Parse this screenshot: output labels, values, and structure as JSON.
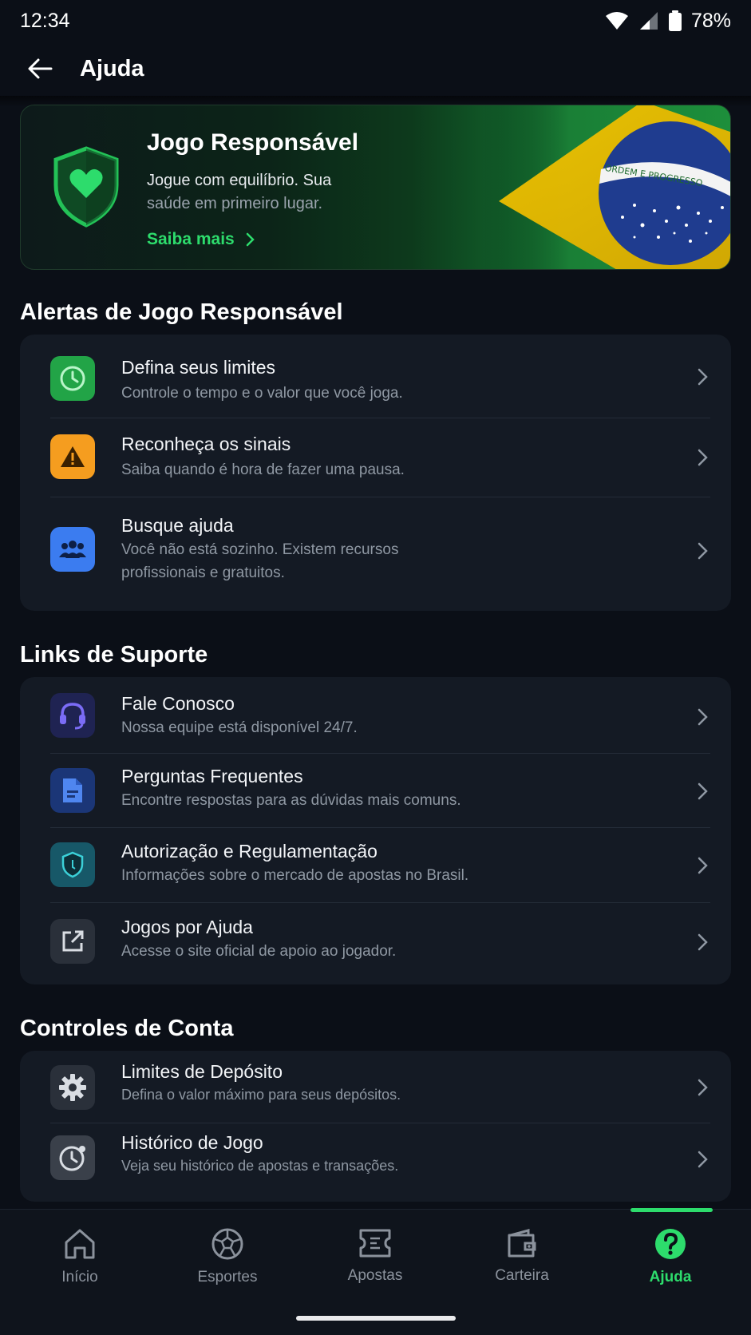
{
  "status": {
    "time": "12:34",
    "battery": "78%"
  },
  "header": {
    "title": "Ajuda",
    "back_icon": "arrow-left-icon"
  },
  "banner": {
    "title": "Jogo Responsável",
    "line1": "Jogue com equilíbrio. Sua",
    "line2": "saúde em primeiro lugar.",
    "link": "Saiba mais",
    "flag_motto": "ORDEM E PROGRESSO"
  },
  "alerts": {
    "title": "Alertas de Jogo Responsável",
    "items": [
      {
        "title": "Defina seus limites",
        "sub": "Controle o tempo e o valor que você joga.",
        "icon": "clock-icon",
        "color": "#22a447"
      },
      {
        "title": "Reconheça os sinais",
        "sub": "Saiba quando é hora de fazer uma pausa.",
        "icon": "warning-icon",
        "color": "#f59d1f"
      },
      {
        "title": "Busque ajuda",
        "sub1": "Você não está sozinho. Existem recursos",
        "sub2": "profissionais e gratuitos.",
        "icon": "group-icon",
        "color": "#3b7cf0"
      }
    ]
  },
  "support": {
    "title": "Links de Suporte",
    "items": [
      {
        "title": "Fale Conosco",
        "sub": "Nossa equipe está disponível 24/7.",
        "icon": "headset-icon"
      },
      {
        "title": "Perguntas Frequentes",
        "sub": "Encontre respostas para as dúvidas mais comuns.",
        "icon": "document-icon"
      },
      {
        "title": "Autorização e Regulamentação",
        "sub": "Informações sobre o mercado de apostas no Brasil.",
        "icon": "shield-icon"
      },
      {
        "title": "Jogos por Ajuda",
        "sub": "Acesse o site oficial de apoio ao jogador.",
        "icon": "external-link-icon"
      }
    ]
  },
  "account": {
    "title": "Controles de Conta",
    "items": [
      {
        "title": "Limites de Depósito",
        "sub": "Defina o valor máximo para seus depósitos.",
        "icon": "gear-icon"
      },
      {
        "title": "Histórico de Jogo",
        "sub": "Veja seu histórico de apostas e transações.",
        "icon": "history-icon"
      }
    ]
  },
  "nav": {
    "items": [
      {
        "label": "Início",
        "icon": "home-icon"
      },
      {
        "label": "Esportes",
        "icon": "ball-icon"
      },
      {
        "label": "Apostas",
        "icon": "ticket-icon"
      },
      {
        "label": "Carteira",
        "icon": "wallet-icon"
      },
      {
        "label": "Ajuda",
        "icon": "help-icon",
        "active": true
      }
    ]
  },
  "colors": {
    "accent": "#2ddc6c",
    "background": "#0b0f17",
    "card": "#141a24"
  }
}
